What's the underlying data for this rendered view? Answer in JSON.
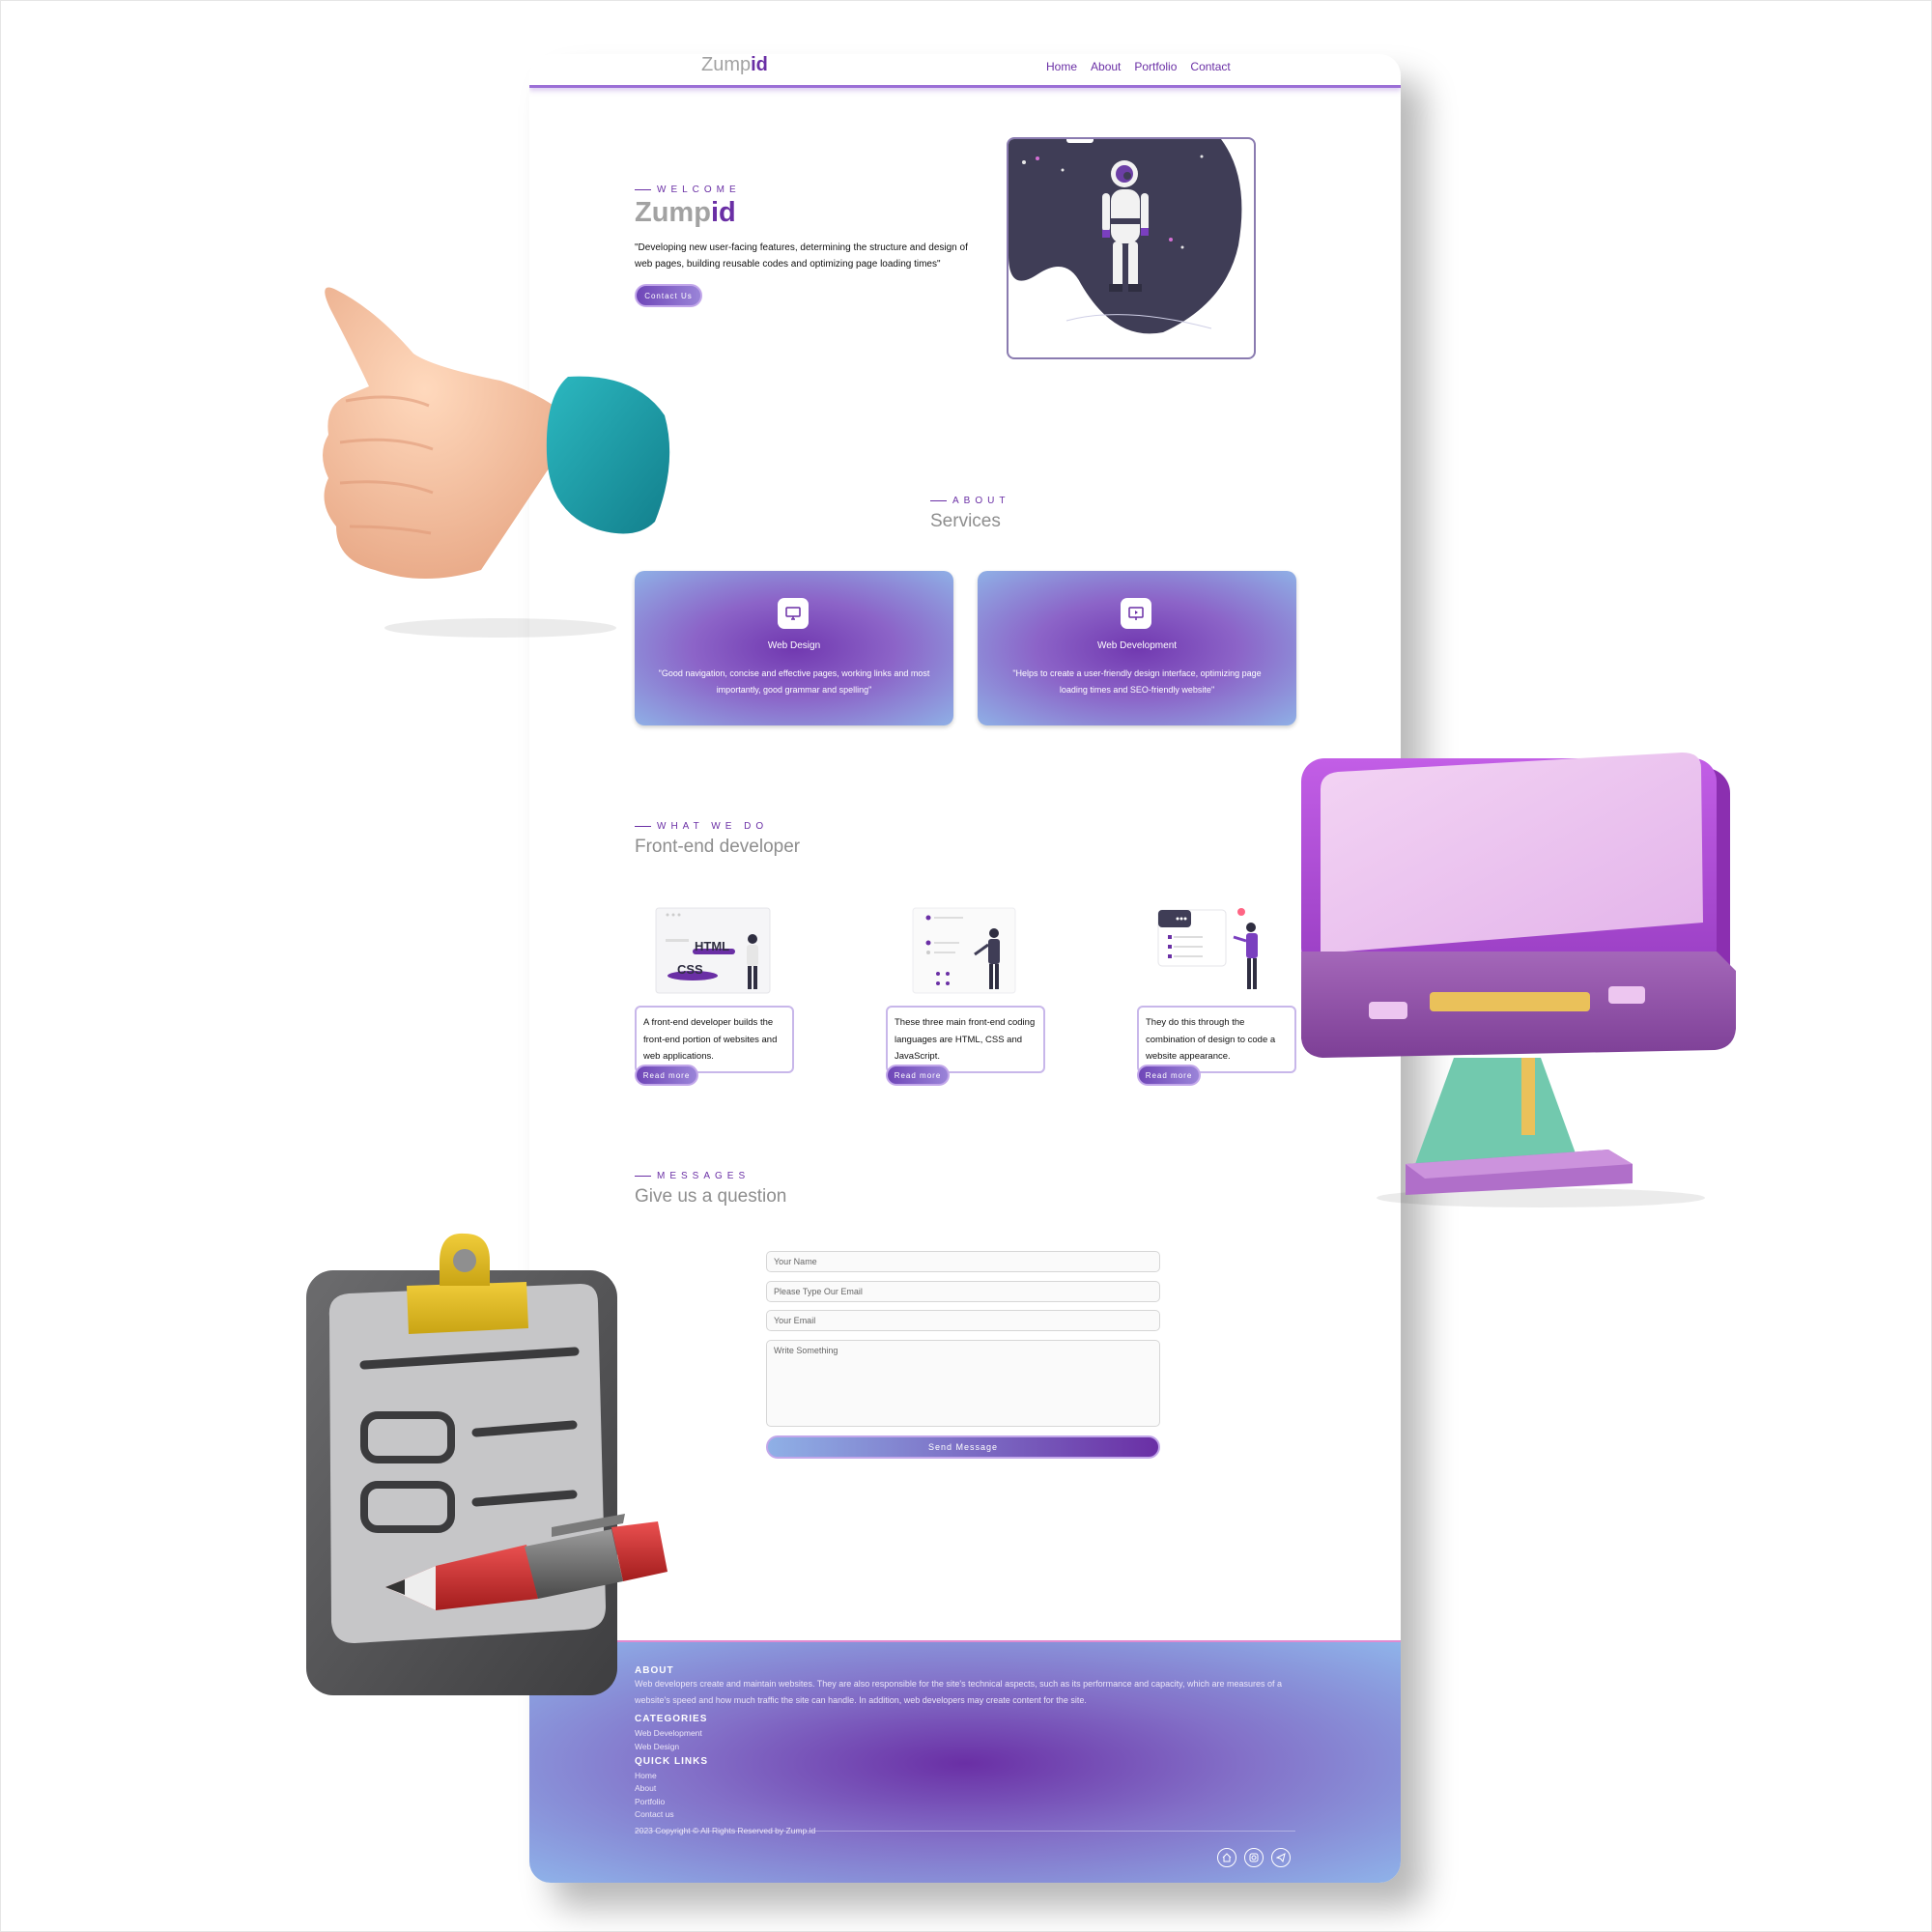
{
  "nav": {
    "logo_main": "Zump",
    "logo_accent": "id",
    "links": [
      "Home",
      "About",
      "Portfolio",
      "Contact"
    ]
  },
  "hero": {
    "eyebrow": "WELCOME",
    "title_main": "Zump",
    "title_accent": "id",
    "text": "\"Developing new user-facing features, determining the structure and design of web pages, building reusable codes and optimizing page loading times\"",
    "button": "Contact Us"
  },
  "about": {
    "eyebrow": "ABOUT",
    "title": "Services",
    "cards": [
      {
        "icon": "monitor-icon",
        "title": "Web Design",
        "text": "\"Good navigation, concise and effective pages, working links and most importantly, good grammar and spelling\""
      },
      {
        "icon": "presentation-icon",
        "title": "Web Development",
        "text": "\"Helps to create a user-friendly design interface, optimizing page loading times and SEO-friendly website\""
      }
    ]
  },
  "work": {
    "eyebrow": "WHAT WE DO",
    "title": "Front-end developer",
    "items": [
      {
        "img_text_1": "HTML",
        "img_text_2": "CSS",
        "text": "A front-end developer builds the front-end portion of websites and web applications.",
        "button": "Read more"
      },
      {
        "text": "These three main front-end coding languages are HTML, CSS and JavaScript.",
        "button": "Read more"
      },
      {
        "text": "They do this through the combination of design to code a website appearance.",
        "button": "Read more"
      }
    ]
  },
  "messages": {
    "eyebrow": "MESSAGES",
    "title": "Give us a question",
    "placeholders": {
      "name": "Your Name",
      "email_type": "Please Type Our Email",
      "email": "Your Email",
      "message": "Write Something"
    },
    "send": "Send Message"
  },
  "footer": {
    "about_heading": "ABOUT",
    "about_text": "Web developers create and maintain websites. They are also responsible for the site's technical aspects, such as its performance and capacity, which are measures of a website's speed and how much traffic the site can handle. In addition, web developers may create content for the site.",
    "categories_heading": "CATEGORIES",
    "categories": [
      "Web Development",
      "Web Design"
    ],
    "quick_heading": "QUICK LINKS",
    "quick_links": [
      "Home",
      "About",
      "Portfolio",
      "Contact us"
    ],
    "copyright": "2023 Copyright © All Rights Reserved by Zump.id",
    "social_icons": [
      "home-icon",
      "instagram-icon",
      "telegram-icon"
    ]
  },
  "colors": {
    "accent": "#6a2fa5",
    "light_blue": "#8fb0e6",
    "logo_gray": "#a2a2a2"
  }
}
